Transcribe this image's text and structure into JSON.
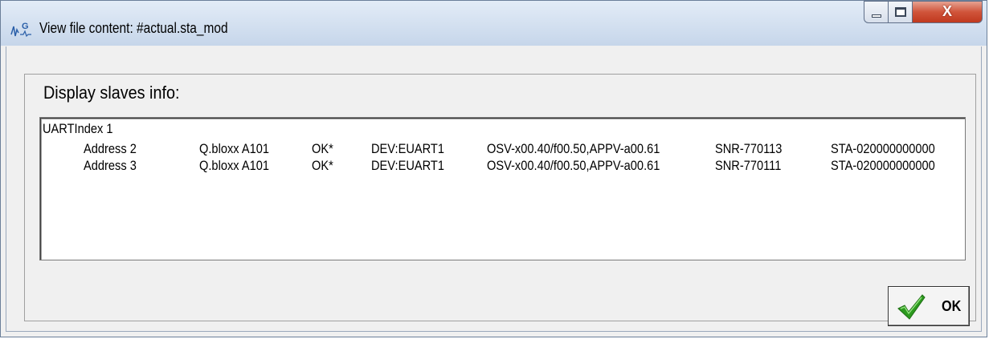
{
  "window": {
    "title": "View file content: #actual.sta_mod",
    "icon": "app-waveform-icon",
    "controls": {
      "minimize_icon": "minimize-icon",
      "maximize_icon": "maximize-icon",
      "close_label": "X"
    }
  },
  "panel": {
    "heading": "Display slaves info:"
  },
  "content": {
    "header": "UARTIndex 1",
    "rows": [
      {
        "address": "Address 2",
        "device": "Q.bloxx A101",
        "status": "OK*",
        "dev": "DEV:EUART1",
        "version": "OSV-x00.40/f00.50,APPV-a00.61",
        "serial": "SNR-770113",
        "sta": "STA-020000000000"
      },
      {
        "address": "Address 3",
        "device": "Q.bloxx A101",
        "status": "OK*",
        "dev": "DEV:EUART1",
        "version": "OSV-x00.40/f00.50,APPV-a00.61",
        "serial": "SNR-770111",
        "sta": "STA-020000000000"
      }
    ]
  },
  "buttons": {
    "ok_label": "OK",
    "ok_icon": "checkmark-icon"
  },
  "colors": {
    "titlebar": "#d3e0f0",
    "close_button": "#c0391f",
    "dialog_bg": "#f0f0f0",
    "check_green": "#2c9a1e"
  }
}
